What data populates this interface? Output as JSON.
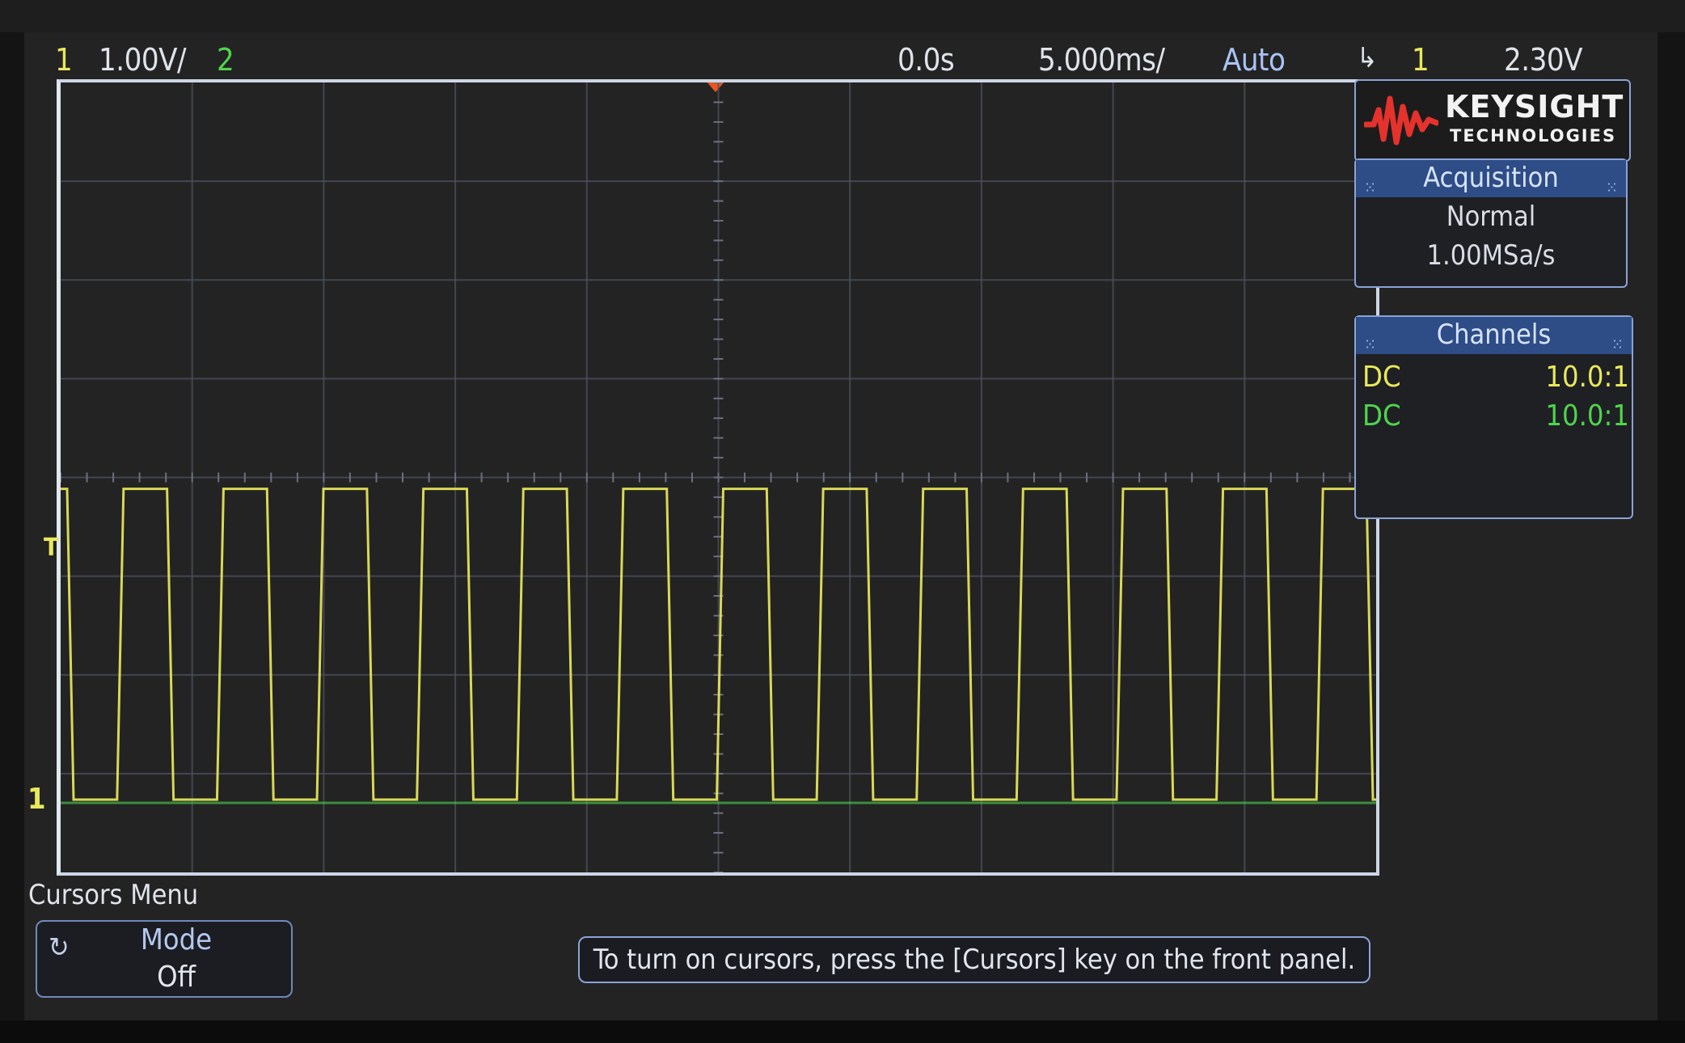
{
  "status_bar": {
    "channel1_number": "1",
    "channel1_scale": "1.00V/",
    "channel2_number": "2",
    "time_delay": "0.0s",
    "timebase": "5.000ms/",
    "trigger_mode": "Auto",
    "trigger_slope_icon": "falling-edge-icon",
    "trigger_source": "1",
    "trigger_level": "2.30V"
  },
  "logo": {
    "line1": "KEYSIGHT",
    "line2": "TECHNOLOGIES"
  },
  "acquisition_panel": {
    "title": "Acquisition",
    "mode": "Normal",
    "sample_rate": "1.00MSa/s"
  },
  "channels_panel": {
    "title": "Channels",
    "rows": [
      {
        "coupling": "DC",
        "probe": "10.0:1",
        "color": "#e9e85c"
      },
      {
        "coupling": "DC",
        "probe": "10.0:1",
        "color": "#4fd44d"
      }
    ]
  },
  "markers": {
    "channel1_ground": "1",
    "trigger_level": "T"
  },
  "softkey_menu": {
    "title": "Cursors Menu",
    "mode_label": "Mode",
    "mode_value": "Off"
  },
  "message": "To turn on cursors, press the [Cursors] key on the front panel.",
  "colors": {
    "channel1": "#e9e85c",
    "channel2": "#4fd44d",
    "panel_header": "#2e4c86",
    "trigger_marker": "#e8561f"
  },
  "waveform": {
    "signal": "square",
    "visible_cycles": 13,
    "duty_cycle": 0.5,
    "high_level_divisions": 3,
    "low_level_divisions": 0
  }
}
